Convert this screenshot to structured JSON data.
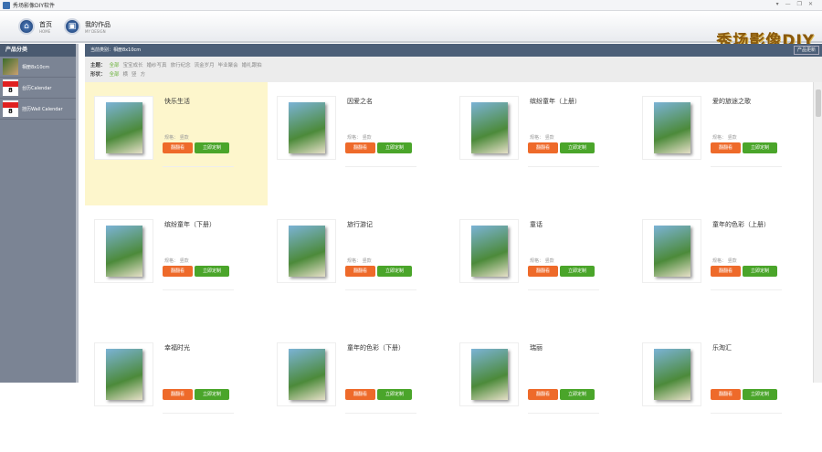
{
  "window": {
    "title": "秀场影像DIY软件",
    "controls": [
      "▾",
      "—",
      "❐",
      "✕"
    ]
  },
  "nav": [
    {
      "label": "首页",
      "sub": "HOME"
    },
    {
      "label": "我的作品",
      "sub": "MY DESIGN"
    }
  ],
  "logo": "秀场影像DIY",
  "sidebar": {
    "title": "产品分类",
    "items": [
      {
        "label": "相册8x10cm",
        "type": "album"
      },
      {
        "label": "台历Calendar",
        "type": "cal"
      },
      {
        "label": "挂历Wall Calendar",
        "type": "cal"
      }
    ]
  },
  "main": {
    "current": "当前类别：相册8x10cm",
    "update": "产品更新"
  },
  "filters": {
    "theme_label": "主题：",
    "themes": [
      "全部",
      "宝宝成长",
      "婚纱写真",
      "旅行纪念",
      "流金岁月",
      "毕业聚会",
      "婚礼跟拍"
    ],
    "shape_label": "形状：",
    "shapes": [
      "全部",
      "横",
      "竖",
      "方"
    ]
  },
  "products": [
    {
      "title": "快乐生活",
      "spec": "规格： 竖款",
      "preview": "翻翻看",
      "custom": "立即定制"
    },
    {
      "title": "因爱之名",
      "spec": "规格： 竖款",
      "preview": "翻翻看",
      "custom": "立即定制"
    },
    {
      "title": "缤纷童年（上册）",
      "spec": "规格： 竖款",
      "preview": "翻翻看",
      "custom": "立即定制"
    },
    {
      "title": "爱的旅途之歌",
      "spec": "规格： 竖款",
      "preview": "翻翻看",
      "custom": "立即定制"
    },
    {
      "title": "缤纷童年（下册）",
      "spec": "规格： 竖款",
      "preview": "翻翻看",
      "custom": "立即定制"
    },
    {
      "title": "旅行游记",
      "spec": "规格： 竖款",
      "preview": "翻翻看",
      "custom": "立即定制"
    },
    {
      "title": "童话",
      "spec": "规格： 竖款",
      "preview": "翻翻看",
      "custom": "立即定制"
    },
    {
      "title": "童年的色彩（上册）",
      "spec": "规格： 竖款",
      "preview": "翻翻看",
      "custom": "立即定制"
    },
    {
      "title": "幸福时光",
      "spec": "",
      "preview": "翻翻看",
      "custom": "立即定制"
    },
    {
      "title": "童年的色彩（下册）",
      "spec": "",
      "preview": "翻翻看",
      "custom": "立即定制"
    },
    {
      "title": "瑞丽",
      "spec": "",
      "preview": "翻翻看",
      "custom": "立即定制"
    },
    {
      "title": "乐淘汇",
      "spec": "",
      "preview": "翻翻看",
      "custom": "立即定制"
    }
  ]
}
